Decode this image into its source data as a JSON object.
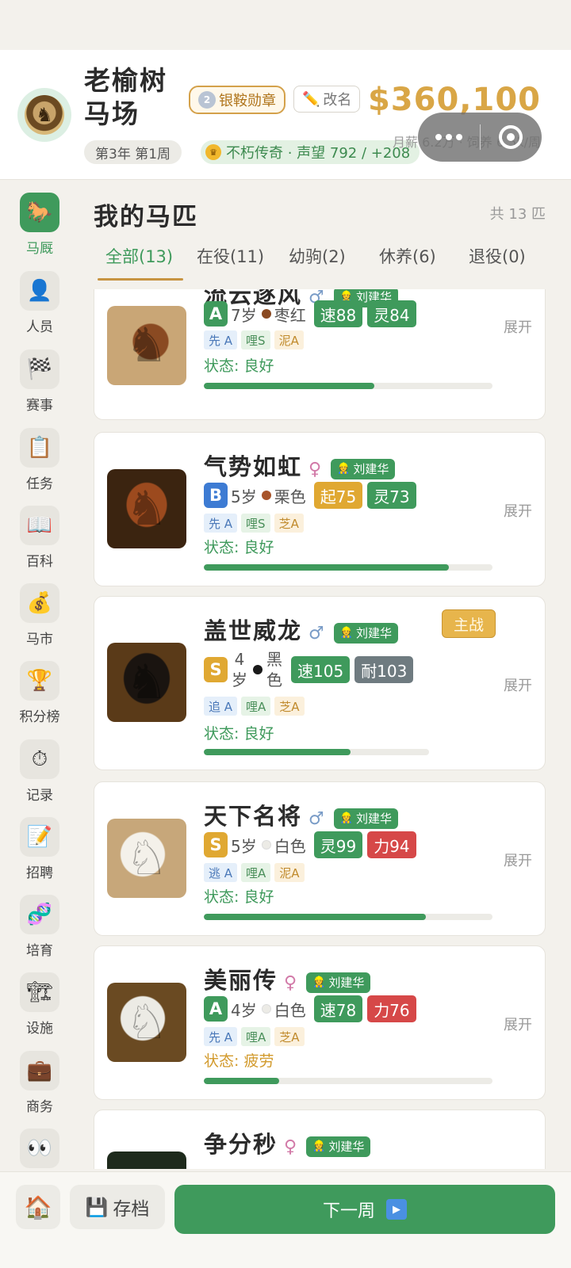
{
  "header": {
    "farm_name": "老榆树马场",
    "medal_label": "银鞍勋章",
    "medal_rank": "2",
    "rename_label": "改名",
    "week_label": "第3年 第1周",
    "fame_label": "不朽传奇 · 声望 792 / +208",
    "money": "$360,100",
    "money_sub": "月薪 6.2万 · 饲养 6.5k/周"
  },
  "sidebar": {
    "items": [
      {
        "label": "马厩",
        "icon": "horse-icon",
        "glyph": "🐎"
      },
      {
        "label": "人员",
        "icon": "person-icon",
        "glyph": "👤"
      },
      {
        "label": "赛事",
        "icon": "checkered-flag-icon",
        "glyph": "🏁"
      },
      {
        "label": "任务",
        "icon": "clipboard-icon",
        "glyph": "📋"
      },
      {
        "label": "百科",
        "icon": "book-icon",
        "glyph": "📖"
      },
      {
        "label": "马市",
        "icon": "money-bag-icon",
        "glyph": "💰"
      },
      {
        "label": "积分榜",
        "icon": "trophy-icon",
        "glyph": "🏆"
      },
      {
        "label": "记录",
        "icon": "stopwatch-icon",
        "glyph": "⏱"
      },
      {
        "label": "招聘",
        "icon": "memo-icon",
        "glyph": "📝"
      },
      {
        "label": "培育",
        "icon": "dna-icon",
        "glyph": "🧬"
      },
      {
        "label": "设施",
        "icon": "crane-icon",
        "glyph": "🏗"
      },
      {
        "label": "商务",
        "icon": "briefcase-icon",
        "glyph": "💼"
      },
      {
        "label": "",
        "icon": "eyes-icon",
        "glyph": "👀"
      }
    ]
  },
  "main": {
    "title": "我的马匹",
    "count": "共 13 匹",
    "tabs": [
      {
        "label": "全部(13)"
      },
      {
        "label": "在役(11)"
      },
      {
        "label": "幼驹(2)"
      },
      {
        "label": "休养(6)"
      },
      {
        "label": "退役(0)"
      }
    ],
    "ace_label": "主战",
    "expand_label": "展开",
    "horses": [
      {
        "name": "流云逐风",
        "gender": "♂",
        "trainer": "刘建华",
        "grade": "A",
        "age": "7岁",
        "color": "枣红",
        "stat1": "速88",
        "stat2": "灵84",
        "apt": [
          "先 A",
          "哩S",
          "泥A"
        ],
        "status": "状态: 良好",
        "condition": 0.59
      },
      {
        "name": "气势如虹",
        "gender": "♀",
        "trainer": "刘建华",
        "grade": "B",
        "age": "5岁",
        "color": "栗色",
        "stat1": "起75",
        "stat2": "灵73",
        "apt": [
          "先 A",
          "哩S",
          "芝A"
        ],
        "status": "状态: 良好",
        "condition": 0.85
      },
      {
        "name": "盖世威龙",
        "gender": "♂",
        "trainer": "刘建华",
        "grade": "S",
        "age": "4岁",
        "color": "黑色",
        "stat1": "速105",
        "stat2": "耐103",
        "apt": [
          "追 A",
          "哩A",
          "芝A"
        ],
        "status": "状态: 良好",
        "condition": 0.65
      },
      {
        "name": "天下名将",
        "gender": "♂",
        "trainer": "刘建华",
        "grade": "S",
        "age": "5岁",
        "color": "白色",
        "stat1": "灵99",
        "stat2": "力94",
        "apt": [
          "逃 A",
          "哩A",
          "泥A"
        ],
        "status": "状态: 良好",
        "condition": 0.77
      },
      {
        "name": "美丽传",
        "gender": "♀",
        "trainer": "刘建华",
        "grade": "A",
        "age": "4岁",
        "color": "白色",
        "stat1": "速78",
        "stat2": "力76",
        "apt": [
          "先 A",
          "哩A",
          "芝A"
        ],
        "status": "状态: 疲劳",
        "condition": 0.26
      },
      {
        "name": "争分秒",
        "gender": "♀",
        "trainer": "刘建华"
      }
    ]
  },
  "bottom": {
    "save_label": "存档",
    "next_label": "下一周"
  }
}
